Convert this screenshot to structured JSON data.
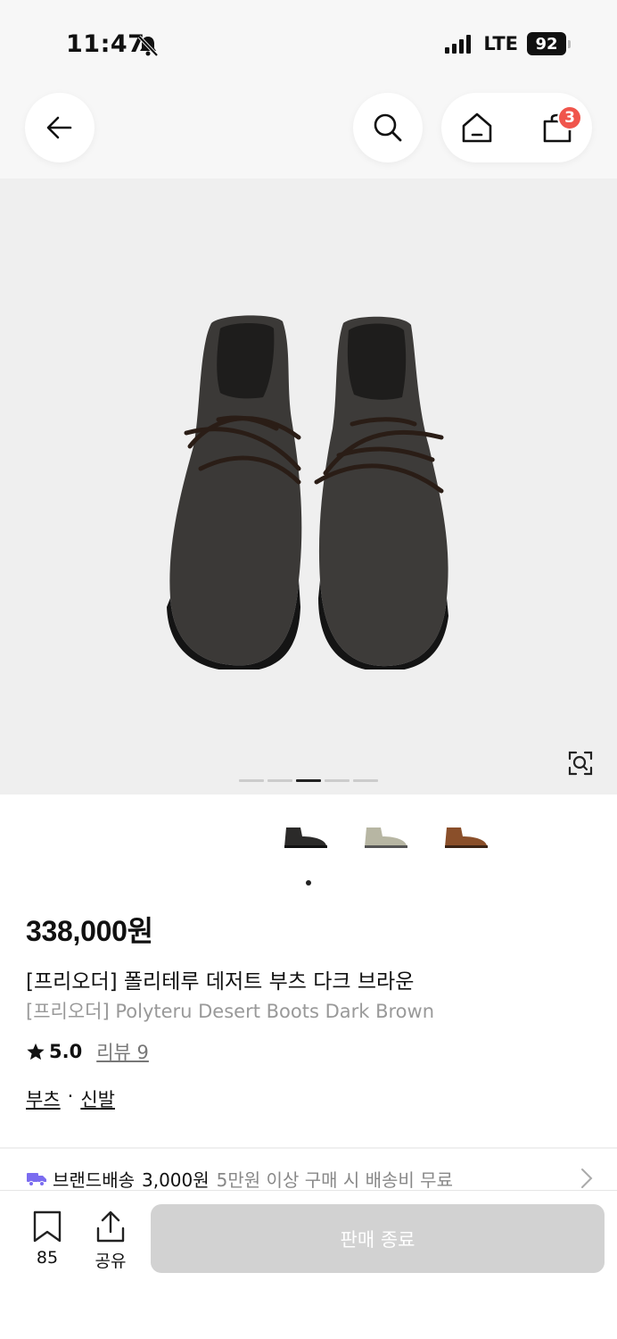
{
  "status_bar": {
    "time": "11:47",
    "network": "LTE",
    "battery": "92"
  },
  "header": {
    "cart_count": "3"
  },
  "gallery": {
    "total_images": 5,
    "active_index": 2
  },
  "colors": [
    "black",
    "beige",
    "brown"
  ],
  "product": {
    "price": "338,000원",
    "title_ko": "[프리오더] 폴리테루 데저트 부츠 다크 브라운",
    "title_en": "[프리오더] Polyteru Desert Boots Dark Brown",
    "rating": "5.0",
    "review_label": "리뷰 9",
    "category_1": "부츠",
    "category_sep": "·",
    "category_2": "신발"
  },
  "shipping": {
    "label": "브랜드배송",
    "fee": "3,000원",
    "condition": "5만원 이상 구매 시 배송비 무료"
  },
  "bottom": {
    "bookmark_count": "85",
    "share_label": "공유",
    "action_label": "판매 종료"
  },
  "accent_colors": {
    "badge": "#f0554c",
    "truck": "#7b6cf0",
    "disabled_button": "#d2d2d2"
  }
}
